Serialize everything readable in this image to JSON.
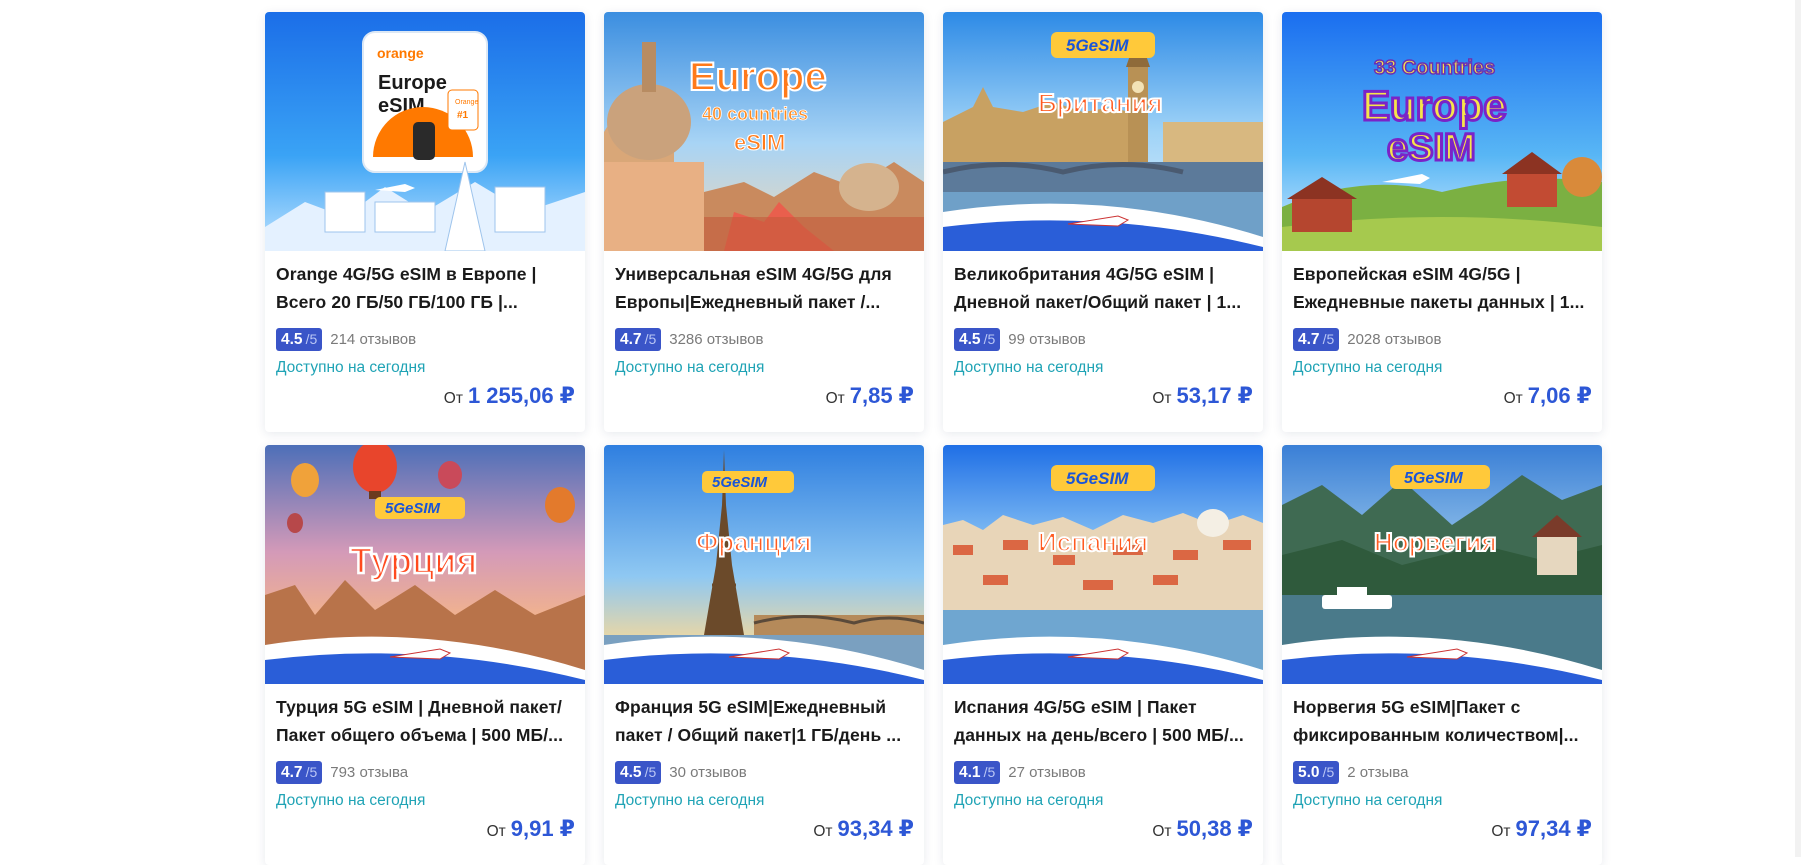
{
  "products": [
    {
      "title": "Orange 4G/5G eSIM в Европе | Всего 20 ГБ/50 ГБ/100 ГБ |...",
      "rating": "4.5",
      "rating_max": "/5",
      "reviews": "214 отзывов",
      "availability": "Доступно на сегодня",
      "price_prefix": "От",
      "price": "1 255,06 ₽",
      "banner": {
        "badge": "",
        "line1": "",
        "line2": "",
        "line3": ""
      },
      "logo": {
        "brand": "orange",
        "line1": "Europe",
        "line2": "eSIM",
        "tag1": "Orange",
        "tag2": "#1"
      }
    },
    {
      "title": "Универсальная eSIM 4G/5G для Европы|Ежедневный пакет /...",
      "rating": "4.7",
      "rating_max": "/5",
      "reviews": "3286 отзывов",
      "availability": "Доступно на сегодня",
      "price_prefix": "От",
      "price": "7,85 ₽",
      "banner": {
        "badge": "",
        "line1": "Europe",
        "line2": "40 countries",
        "line3": "eSIM"
      }
    },
    {
      "title": "Великобритания 4G/5G eSIM | Дневной пакет/Общий пакет | 1...",
      "rating": "4.5",
      "rating_max": "/5",
      "reviews": "99 отзывов",
      "availability": "Доступно на сегодня",
      "price_prefix": "От",
      "price": "53,17 ₽",
      "banner": {
        "badge": "5GeSIM",
        "line1": "Британия",
        "line2": "",
        "line3": ""
      }
    },
    {
      "title": "Европейская eSIM 4G/5G | Ежедневные пакеты данных | 1...",
      "rating": "4.7",
      "rating_max": "/5",
      "reviews": "2028 отзывов",
      "availability": "Доступно на сегодня",
      "price_prefix": "От",
      "price": "7,06 ₽",
      "banner": {
        "badge": "",
        "line1": "33 Countries",
        "line2": "Europe",
        "line3": "eSIM"
      }
    },
    {
      "title": "Турция 5G eSIM | Дневной пакет/Пакет общего объема | 500 МБ/...",
      "rating": "4.7",
      "rating_max": "/5",
      "reviews": "793 отзыва",
      "availability": "Доступно на сегодня",
      "price_prefix": "От",
      "price": "9,91 ₽",
      "banner": {
        "badge": "5GeSIM",
        "line1": "Турция",
        "line2": "",
        "line3": ""
      }
    },
    {
      "title": "Франция 5G eSIM|Ежедневный пакет / Общий пакет|1 ГБ/день ...",
      "rating": "4.5",
      "rating_max": "/5",
      "reviews": "30 отзывов",
      "availability": "Доступно на сегодня",
      "price_prefix": "От",
      "price": "93,34 ₽",
      "banner": {
        "badge": "5GeSIM",
        "line1": "Франция",
        "line2": "",
        "line3": ""
      }
    },
    {
      "title": "Испания 4G/5G eSIM | Пакет данных на день/всего | 500 МБ/...",
      "rating": "4.1",
      "rating_max": "/5",
      "reviews": "27 отзывов",
      "availability": "Доступно на сегодня",
      "price_prefix": "От",
      "price": "50,38 ₽",
      "banner": {
        "badge": "5GeSIM",
        "line1": "Испания",
        "line2": "",
        "line3": ""
      }
    },
    {
      "title": "Норвегия 5G eSIM|Пакет с фиксированным количеством|...",
      "rating": "5.0",
      "rating_max": "/5",
      "reviews": "2 отзыва",
      "availability": "Доступно на сегодня",
      "price_prefix": "От",
      "price": "97,34 ₽",
      "banner": {
        "badge": "5GeSIM",
        "line1": "Норвегия",
        "line2": "",
        "line3": ""
      }
    }
  ]
}
